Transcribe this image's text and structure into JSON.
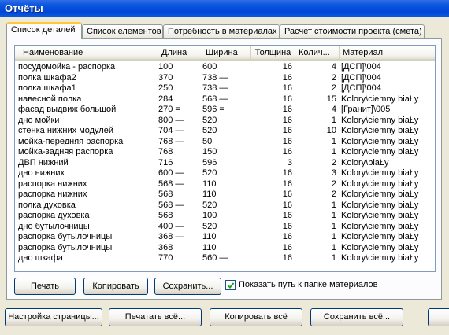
{
  "window": {
    "title": "Отчёты"
  },
  "tabs": [
    {
      "label": "Список деталей"
    },
    {
      "label": "Список елементов"
    },
    {
      "label": "Потребность в материалах"
    },
    {
      "label": "Расчет стоимости проекта (смета)"
    }
  ],
  "table": {
    "columns": [
      "Наименование",
      "Длина",
      "Ширина",
      "Толщина",
      "Колич...",
      "Материал"
    ],
    "rows": [
      [
        "посудомойка - распорка",
        "100",
        "600",
        "16",
        "4",
        "[ДСП]\\004"
      ],
      [
        "полка шкафа2",
        "370",
        "738 —",
        "16",
        "2",
        "[ДСП]\\004"
      ],
      [
        "полка шкафа1",
        "250",
        "738 —",
        "16",
        "2",
        "[ДСП]\\004"
      ],
      [
        "навесной полка",
        "284",
        "568 —",
        "16",
        "15",
        "Kolory\\ciemny biaŁy"
      ],
      [
        "фасад выдвиж большой",
        "270 =",
        "596 =",
        "16",
        "4",
        "[Гранит]\\005"
      ],
      [
        "дно мойки",
        "800 —",
        "520",
        "16",
        "1",
        "Kolory\\ciemny biaŁy"
      ],
      [
        "стенка нижних модулей",
        "704 —",
        "520",
        "16",
        "10",
        "Kolory\\ciemny biaŁy"
      ],
      [
        "мойка-передняя распорка",
        "768 —",
        "50",
        "16",
        "1",
        "Kolory\\ciemny biaŁy"
      ],
      [
        "мойка-задняя распорка",
        "768",
        "150",
        "16",
        "1",
        "Kolory\\ciemny biaŁy"
      ],
      [
        "ДВП нижний",
        "716",
        "596",
        "3",
        "2",
        "Kolory\\biaŁy"
      ],
      [
        "дно нижних",
        "600 —",
        "520",
        "16",
        "3",
        "Kolory\\ciemny biaŁy"
      ],
      [
        "распорка нижних",
        "568 —",
        "110",
        "16",
        "2",
        "Kolory\\ciemny biaŁy"
      ],
      [
        "распорка нижних",
        "568",
        "110",
        "16",
        "2",
        "Kolory\\ciemny biaŁy"
      ],
      [
        "полка духовка",
        "568 —",
        "520",
        "16",
        "1",
        "Kolory\\ciemny biaŁy"
      ],
      [
        "распорка духовка",
        "568",
        "100",
        "16",
        "1",
        "Kolory\\ciemny biaŁy"
      ],
      [
        "дно бутылочницы",
        "400 —",
        "520",
        "16",
        "1",
        "Kolory\\ciemny biaŁy"
      ],
      [
        "распорка бутылочницы",
        "368 —",
        "110",
        "16",
        "1",
        "Kolory\\ciemny biaŁy"
      ],
      [
        "распорка бутылочницы",
        "368",
        "110",
        "16",
        "1",
        "Kolory\\ciemny biaŁy"
      ],
      [
        "дно шкафа",
        "770",
        "560 —",
        "16",
        "1",
        "Kolory\\ciemny biaŁy"
      ]
    ]
  },
  "panel_buttons": {
    "print": "Печать",
    "copy": "Копировать",
    "save": "Сохранить...",
    "show_path_label": "Показать путь к папке материалов",
    "show_path_checked": true
  },
  "bottom_buttons": {
    "page_setup": "Настройка страницы...",
    "print_all": "Печатать всё...",
    "copy_all": "Копировать всё",
    "save_all": "Сохранить всё..."
  },
  "colors": {
    "titlebar": "#0a55de",
    "active_tab_accent": "#ffc83c",
    "window_bg": "#ece9d8"
  }
}
